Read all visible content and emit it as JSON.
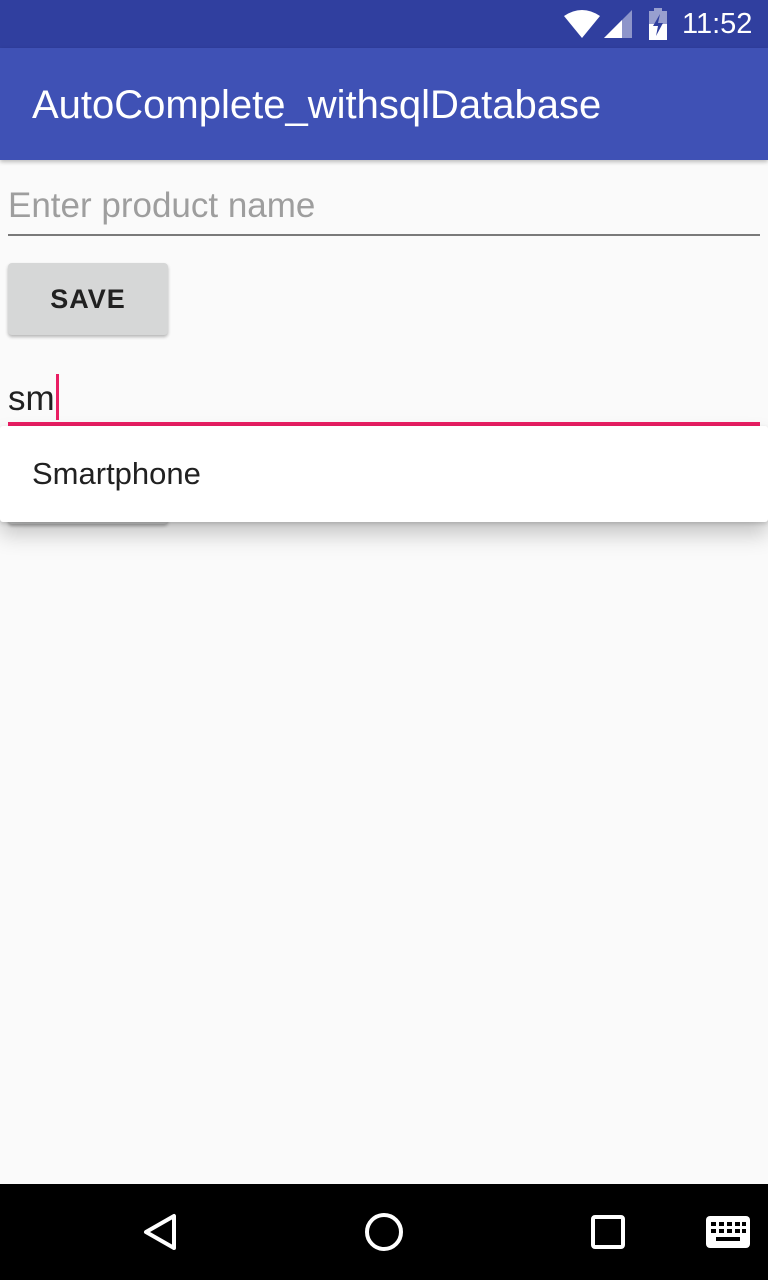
{
  "status_bar": {
    "time": "11:52",
    "icons": [
      "wifi-icon",
      "signal-icon",
      "battery-charging-icon"
    ],
    "background": "#303f9f"
  },
  "toolbar": {
    "title": "AutoComplete_withsqlDatabase",
    "background": "#3f51b5"
  },
  "form": {
    "product_input": {
      "placeholder": "Enter product name",
      "value": ""
    },
    "save_button": {
      "label": "SAVE"
    },
    "search_input": {
      "value": "sm",
      "accent": "#e91e63"
    }
  },
  "autocomplete": {
    "suggestions": [
      "Smartphone"
    ]
  },
  "nav_bar": {
    "buttons": [
      "back-icon",
      "home-icon",
      "recents-icon",
      "keyboard-icon"
    ]
  }
}
